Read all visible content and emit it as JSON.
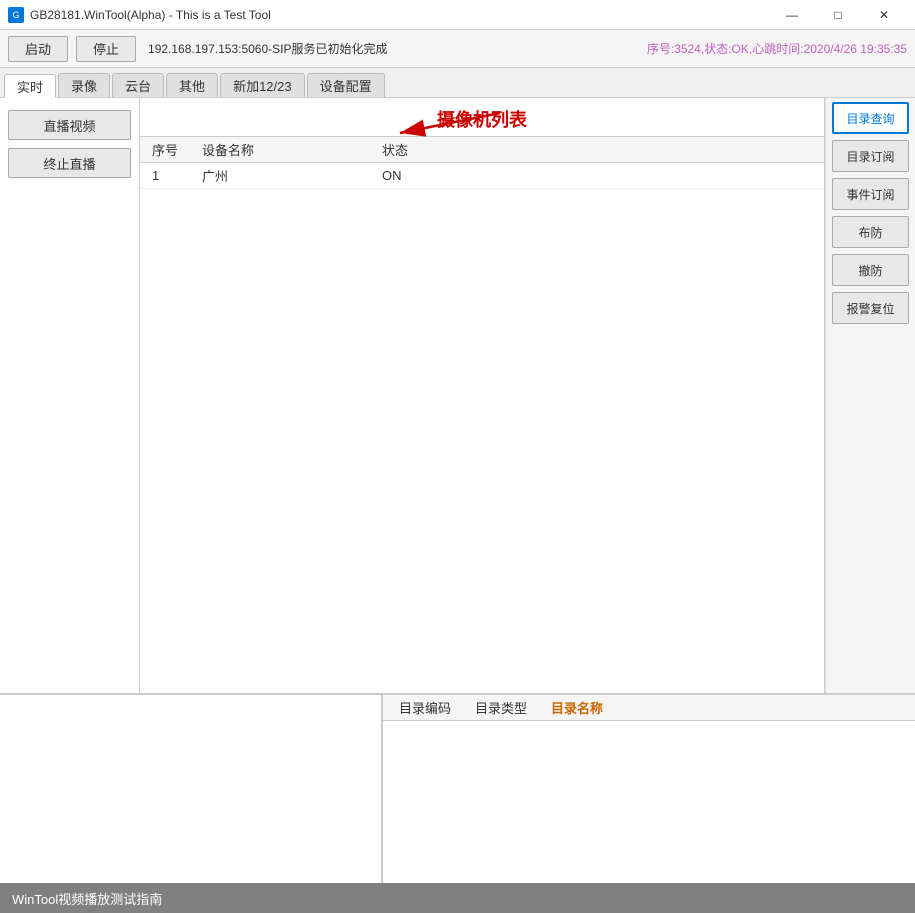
{
  "titlebar": {
    "title": "GB28181.WinTool(Alpha) - This is a Test Tool",
    "icon": "G",
    "controls": {
      "minimize": "—",
      "maximize": "□",
      "close": "✕"
    }
  },
  "toolbar": {
    "start_label": "启动",
    "stop_label": "停止",
    "status_text": "192.168.197.153:5060-SIP服务已初始化完成",
    "info_text": "序号:3524,状态:OK,心跳时间:2020/4/26 19:35:35"
  },
  "tabs": [
    {
      "label": "实时",
      "active": true
    },
    {
      "label": "录像",
      "active": false
    },
    {
      "label": "云台",
      "active": false
    },
    {
      "label": "其他",
      "active": false
    },
    {
      "label": "新加12/23",
      "active": false
    },
    {
      "label": "设备配置",
      "active": false
    }
  ],
  "camera_list": {
    "title": "摄像机列表",
    "columns": {
      "seq": "序号",
      "name": "设备名称",
      "status": "状态"
    },
    "rows": [
      {
        "seq": "1",
        "name": "广州",
        "status": "ON"
      }
    ]
  },
  "left_panel": {
    "live_button": "直播视频",
    "stop_live_button": "终止直播"
  },
  "right_panel": {
    "buttons": [
      {
        "label": "目录查询",
        "active": true
      },
      {
        "label": "目录订阅"
      },
      {
        "label": "事件订阅"
      },
      {
        "label": "布防"
      },
      {
        "label": "撤防"
      },
      {
        "label": "报警复位"
      }
    ]
  },
  "bottom_table": {
    "columns": [
      {
        "label": "目录编码",
        "highlight": false
      },
      {
        "label": "目录类型",
        "highlight": false
      },
      {
        "label": "目录名称",
        "highlight": true
      }
    ]
  },
  "footer": {
    "text": "WinTool视频播放测试指南"
  }
}
